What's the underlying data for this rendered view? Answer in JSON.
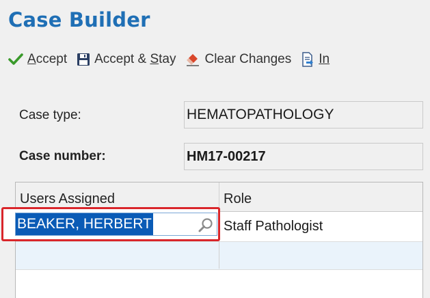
{
  "header": {
    "title": "Case Builder"
  },
  "toolbar": {
    "accept": {
      "pre": "",
      "key": "A",
      "post": "ccept",
      "icon": "check-icon"
    },
    "accept_stay": {
      "pre": "Accept & ",
      "key": "S",
      "post": "tay",
      "icon": "save-icon"
    },
    "clear_changes": {
      "pre": "Clear Chan",
      "key": "g",
      "post": "es",
      "icon": "eraser-icon"
    },
    "import": {
      "pre": "",
      "key": "In",
      "post": "",
      "icon": "import-icon"
    }
  },
  "form": {
    "case_type_label": "Case type:",
    "case_type_value": "HEMATOPATHOLOGY",
    "case_number_label": "Case number:",
    "case_number_value": "HM17-00217"
  },
  "grid": {
    "columns": [
      "Users Assigned",
      "Role"
    ],
    "rows": [
      {
        "user": "BEAKER, HERBERT",
        "role": "Staff Pathologist"
      }
    ]
  },
  "colors": {
    "title": "#1f6fb5",
    "accept_check": "#3a9a2b",
    "highlight": "#0a5bb6",
    "focus_border": "#d9262b"
  }
}
